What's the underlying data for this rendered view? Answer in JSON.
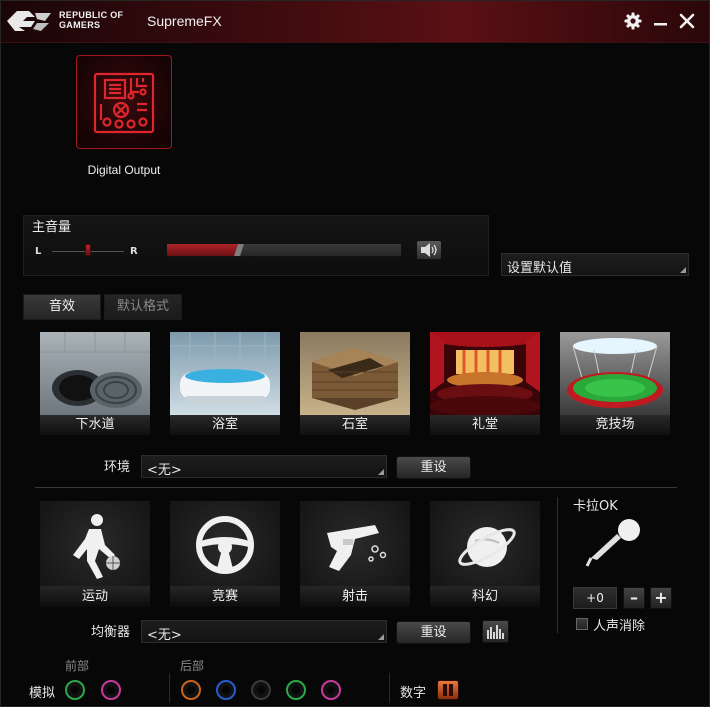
{
  "window": {
    "brand_line1": "REPUBLIC OF",
    "brand_line2": "GAMERS",
    "app_title": "SupremeFX"
  },
  "device": {
    "label": "Digital Output"
  },
  "master_volume": {
    "title": "主音量",
    "left_label": "L",
    "right_label": "R",
    "balance": 0.5,
    "level": 0.3
  },
  "default_select": {
    "value": "设置默认值"
  },
  "tabs": [
    {
      "label": "音效",
      "active": true
    },
    {
      "label": "默认格式",
      "active": false
    }
  ],
  "environments": [
    {
      "label": "下水道",
      "icon": "sewer-icon"
    },
    {
      "label": "浴室",
      "icon": "bathroom-icon"
    },
    {
      "label": "石室",
      "icon": "stone-room-icon"
    },
    {
      "label": "礼堂",
      "icon": "auditorium-icon"
    },
    {
      "label": "竞技场",
      "icon": "arena-icon"
    }
  ],
  "environment_row": {
    "label": "环境",
    "value": "<无>",
    "reset_label": "重设"
  },
  "presets": [
    {
      "label": "运动",
      "icon": "sports-icon"
    },
    {
      "label": "竞赛",
      "icon": "racing-icon"
    },
    {
      "label": "射击",
      "icon": "shooter-icon"
    },
    {
      "label": "科幻",
      "icon": "sci-fi-icon"
    }
  ],
  "equalizer_row": {
    "label": "均衡器",
    "value": "<无>",
    "reset_label": "重设"
  },
  "karaoke": {
    "title": "卡拉OK",
    "value": "+0",
    "minus": "–",
    "plus": "+",
    "vocal_cancel_label": "人声消除",
    "vocal_cancel_checked": false
  },
  "bottom": {
    "front_label": "前部",
    "rear_label": "后部",
    "analog_label": "模拟",
    "digital_label": "数字",
    "front_jacks": [
      "#2aa84a",
      "#c83a9a"
    ],
    "rear_jacks": [
      "#c8641e",
      "#2a5ad0",
      "#3a3a3a",
      "#2aa84a",
      "#c83a9a"
    ]
  },
  "colors": {
    "accent": "#c0212a",
    "background": "#070707"
  }
}
